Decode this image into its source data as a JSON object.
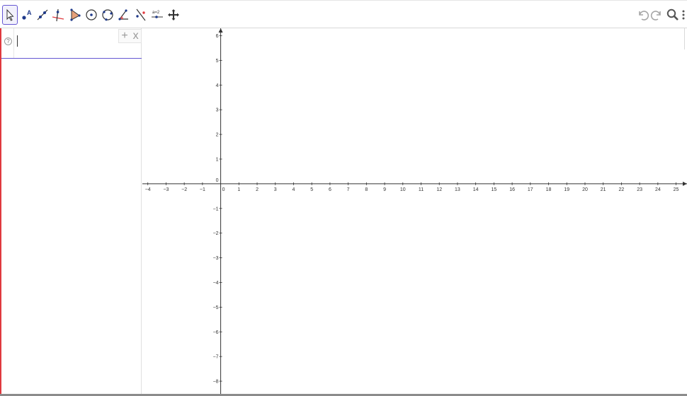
{
  "toolbar": {
    "tools": [
      {
        "name": "move-tool-icon",
        "selected": true
      },
      {
        "name": "point-tool-icon"
      },
      {
        "name": "line-tool-icon"
      },
      {
        "name": "perpendicular-line-tool-icon"
      },
      {
        "name": "polygon-tool-icon"
      },
      {
        "name": "circle-center-point-tool-icon"
      },
      {
        "name": "circle-through-points-tool-icon"
      },
      {
        "name": "angle-tool-icon"
      },
      {
        "name": "reflect-tool-icon"
      },
      {
        "name": "slider-tool-icon",
        "label": "a=2"
      },
      {
        "name": "move-graphics-view-tool-icon"
      }
    ],
    "right": [
      "undo-icon",
      "redo-icon",
      "search-icon",
      "more-icon"
    ]
  },
  "algebra": {
    "help_icon": "?",
    "input_value": "",
    "add_label": "+",
    "close_label": "x"
  },
  "graphics": {
    "x_ticks": [
      "−4",
      "−3",
      "−2",
      "−1",
      "0",
      "1",
      "2",
      "3",
      "4",
      "5",
      "6",
      "7",
      "8",
      "9",
      "10",
      "11",
      "12",
      "13",
      "14",
      "15",
      "16",
      "17",
      "18",
      "19",
      "20",
      "21",
      "22",
      "23",
      "24",
      "25"
    ],
    "y_ticks": [
      "6",
      "5",
      "4",
      "3",
      "2",
      "1",
      "0",
      "−1",
      "−2",
      "−3",
      "−4",
      "−5",
      "−6",
      "−7",
      "−8"
    ],
    "x_range": [
      -4.3,
      25.6
    ],
    "y_range": [
      -8.6,
      6.3
    ]
  },
  "colors": {
    "selection": "#6557d2",
    "point": "#1f3a8a",
    "accent_red": "#e0393e",
    "axis": "#333333"
  }
}
